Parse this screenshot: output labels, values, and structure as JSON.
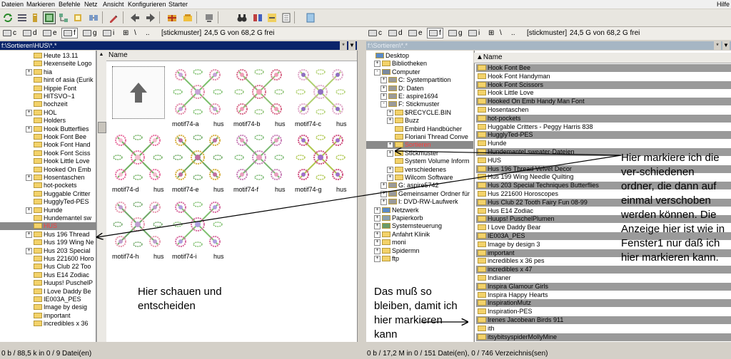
{
  "menu": [
    "Dateien",
    "Markieren",
    "Befehle",
    "Netz",
    "Ansicht",
    "Konfigurieren",
    "Starter"
  ],
  "menu_help": "Hilfe",
  "drives": [
    "c",
    "d",
    "e",
    "f",
    "g",
    "i"
  ],
  "drive_separator": "\\",
  "drive_dots": "..",
  "volume_label": "[stickmuster]",
  "volume_free": "24,5 G von 68,2 G frei",
  "left_path": "f:\\Sortieren\\HUS\\*.*",
  "right_path": "f:\\Sortieren\\*.*",
  "path_star": "*",
  "column_name": "Name",
  "left_tree": [
    {
      "label": "Heute 13.11",
      "pm": ""
    },
    {
      "label": "Hexenseite Logo",
      "pm": ""
    },
    {
      "label": "hia",
      "pm": "+"
    },
    {
      "label": "hint of asia (Eurik",
      "pm": ""
    },
    {
      "label": "Hippie Font",
      "pm": ""
    },
    {
      "label": "HITSVO~1",
      "pm": ""
    },
    {
      "label": "hochzeit",
      "pm": ""
    },
    {
      "label": "HOL",
      "pm": "+"
    },
    {
      "label": "Holders",
      "pm": ""
    },
    {
      "label": "Hook Butterflies",
      "pm": "+"
    },
    {
      "label": "Hook Font Bee",
      "pm": ""
    },
    {
      "label": "Hook Font Hand",
      "pm": ""
    },
    {
      "label": "Hook Font Sciss",
      "pm": ""
    },
    {
      "label": "Hook Little Love",
      "pm": ""
    },
    {
      "label": "Hooked On Emb",
      "pm": ""
    },
    {
      "label": "Hosentaschen",
      "pm": "+"
    },
    {
      "label": "hot-pockets",
      "pm": ""
    },
    {
      "label": "Huggable Critter",
      "pm": ""
    },
    {
      "label": "HugglyTed-PES",
      "pm": ""
    },
    {
      "label": "Hunde",
      "pm": "+"
    },
    {
      "label": "Hundemantel sw",
      "pm": ""
    },
    {
      "label": "HUS",
      "pm": "",
      "selected": true
    },
    {
      "label": "Hus 196 Thread",
      "pm": "+"
    },
    {
      "label": "Hus 199 Wing Ne",
      "pm": ""
    },
    {
      "label": "Hus 203 Special",
      "pm": "+"
    },
    {
      "label": "Hus 221600 Horo",
      "pm": ""
    },
    {
      "label": "Hus Club 22 Too",
      "pm": ""
    },
    {
      "label": "Hus E14 Zodiac",
      "pm": ""
    },
    {
      "label": "Huups! PuschelP",
      "pm": ""
    },
    {
      "label": "I Love Daddy Be",
      "pm": ""
    },
    {
      "label": "IE003A_PES",
      "pm": ""
    },
    {
      "label": "Image  by desig",
      "pm": ""
    },
    {
      "label": "important",
      "pm": ""
    },
    {
      "label": "incredibles x 36",
      "pm": ""
    }
  ],
  "thumbnails": [
    {
      "name": "",
      "ext": "",
      "type": "up"
    },
    {
      "name": "motif74-a",
      "ext": "hus",
      "type": "a"
    },
    {
      "name": "motif74-b",
      "ext": "hus",
      "type": "b"
    },
    {
      "name": "motif74-c",
      "ext": "hus",
      "type": "c"
    },
    {
      "name": "motif74-d",
      "ext": "hus",
      "type": "d"
    },
    {
      "name": "motif74-e",
      "ext": "hus",
      "type": "e"
    },
    {
      "name": "motif74-f",
      "ext": "hus",
      "type": "f"
    },
    {
      "name": "motif74-g",
      "ext": "hus",
      "type": "g"
    },
    {
      "name": "motif74-h",
      "ext": "hus",
      "type": "h"
    },
    {
      "name": "motif74-i",
      "ext": "hus",
      "type": "i"
    }
  ],
  "right_tree": [
    {
      "label": "Desktop",
      "indent": 0,
      "pm": "",
      "kind": "desktop"
    },
    {
      "label": "Bibliotheken",
      "indent": 1,
      "pm": "+",
      "kind": "folder"
    },
    {
      "label": "Computer",
      "indent": 1,
      "pm": "-",
      "kind": "computer"
    },
    {
      "label": "C:  Systempartition",
      "indent": 2,
      "pm": "+",
      "kind": "drive"
    },
    {
      "label": "D:  Daten",
      "indent": 2,
      "pm": "+",
      "kind": "drive"
    },
    {
      "label": "E:  aspire1694",
      "indent": 2,
      "pm": "+",
      "kind": "drive"
    },
    {
      "label": "F:  Stickmuster",
      "indent": 2,
      "pm": "-",
      "kind": "drive"
    },
    {
      "label": "$RECYCLE.BIN",
      "indent": 3,
      "pm": "+",
      "kind": "folder"
    },
    {
      "label": "Buzz",
      "indent": 3,
      "pm": "+",
      "kind": "folder"
    },
    {
      "label": "Embird Handbücher",
      "indent": 3,
      "pm": "",
      "kind": "folder"
    },
    {
      "label": "Floriani Thread Conve",
      "indent": 3,
      "pm": "",
      "kind": "folder"
    },
    {
      "label": "Sortieren",
      "indent": 3,
      "pm": "+",
      "kind": "folder",
      "selected": true
    },
    {
      "label": "Stickmuster",
      "indent": 3,
      "pm": "+",
      "kind": "folder"
    },
    {
      "label": "System Volume Inform",
      "indent": 3,
      "pm": "",
      "kind": "folder"
    },
    {
      "label": "verschiedenes",
      "indent": 3,
      "pm": "+",
      "kind": "folder"
    },
    {
      "label": "Wilcom Software",
      "indent": 3,
      "pm": "+",
      "kind": "folder"
    },
    {
      "label": "G:  aspire5742",
      "indent": 2,
      "pm": "+",
      "kind": "drive"
    },
    {
      "label": "Gemeinsamer Ordner für",
      "indent": 2,
      "pm": "+",
      "kind": "drive"
    },
    {
      "label": "I:  DVD-RW-Laufwerk",
      "indent": 2,
      "pm": "+",
      "kind": "drive"
    },
    {
      "label": "Netzwerk",
      "indent": 1,
      "pm": "+",
      "kind": "network"
    },
    {
      "label": "Papierkorb",
      "indent": 1,
      "pm": "+",
      "kind": "trash"
    },
    {
      "label": "Systemsteuerung",
      "indent": 1,
      "pm": "+",
      "kind": "control"
    },
    {
      "label": "Anfahrt Klinik",
      "indent": 1,
      "pm": "+",
      "kind": "folder"
    },
    {
      "label": "moni",
      "indent": 1,
      "pm": "+",
      "kind": "folder"
    },
    {
      "label": "Spidermn",
      "indent": 1,
      "pm": "+",
      "kind": "folder"
    },
    {
      "label": "ftp",
      "indent": 1,
      "pm": "+",
      "kind": "folder"
    }
  ],
  "right_list": [
    {
      "label": "Hook Font Bee",
      "dark": true
    },
    {
      "label": "Hook Font Handyman",
      "dark": false
    },
    {
      "label": "Hook Font Scissors",
      "dark": true
    },
    {
      "label": "Hook Little Love",
      "dark": false
    },
    {
      "label": "Hooked On Emb Handy Man Font",
      "dark": true
    },
    {
      "label": "Hosentaschen",
      "dark": false
    },
    {
      "label": "hot-pockets",
      "dark": true
    },
    {
      "label": "Huggable Critters - Peggy Harris  838",
      "dark": false
    },
    {
      "label": "HugglyTed-PES",
      "dark": true
    },
    {
      "label": "Hunde",
      "dark": false
    },
    {
      "label": "Hundemantel sweater-Dateien",
      "dark": true
    },
    {
      "label": "HUS",
      "dark": false
    },
    {
      "label": "Hus 196 Thread Velvet Decor",
      "dark": true
    },
    {
      "label": "Hus 199 Wing Needle Quilting",
      "dark": false
    },
    {
      "label": "Hus 203 Special Techniques Butterflies",
      "dark": true
    },
    {
      "label": "Hus 221600 Horoscopes",
      "dark": false
    },
    {
      "label": "Hus Club 22 Tooth Fairy Fun 08-99",
      "dark": true
    },
    {
      "label": "Hus E14 Zodiac",
      "dark": false
    },
    {
      "label": "Huups! PuschelPlumen",
      "dark": true
    },
    {
      "label": "I Love Daddy Bear",
      "dark": false
    },
    {
      "label": "IE003A_PES",
      "dark": true
    },
    {
      "label": "Image  by design 3",
      "dark": false
    },
    {
      "label": "important",
      "dark": true
    },
    {
      "label": "incredibles x 36 pes",
      "dark": false
    },
    {
      "label": "incredibles x 47",
      "dark": true
    },
    {
      "label": "Indianer",
      "dark": false
    },
    {
      "label": "Inspira Glamour Girls",
      "dark": true
    },
    {
      "label": "Inspira Happy Hearts",
      "dark": false
    },
    {
      "label": "InspirationMutz",
      "dark": true
    },
    {
      "label": "Inspiration-PES",
      "dark": false
    },
    {
      "label": "Irenes Jacobean Birds 911",
      "dark": true
    },
    {
      "label": "ith",
      "dark": false
    },
    {
      "label": "itsybitsyspiderMollyMine",
      "dark": true
    }
  ],
  "notes": {
    "left": "Hier schauen und entscheiden",
    "middle": "Das muß so bleiben, damit ich hier markieren kann",
    "right": "Hier markiere ich die ver-schiedenen ordner, die dann auf einmal verschoben werden können. Die Anzeige hier ist wie in Fenster1 nur daß ich hier markieren kann."
  },
  "status_left": "0 b / 88,5 k in 0 / 9 Datei(en)",
  "status_right": "0 b / 17,2 M in 0 / 151 Datei(en), 0 / 746 Verzeichnis(sen)",
  "colors": {
    "active_path": "#0a246a",
    "selection_text": "#ff3b3b",
    "folder": "#f3d26a"
  }
}
